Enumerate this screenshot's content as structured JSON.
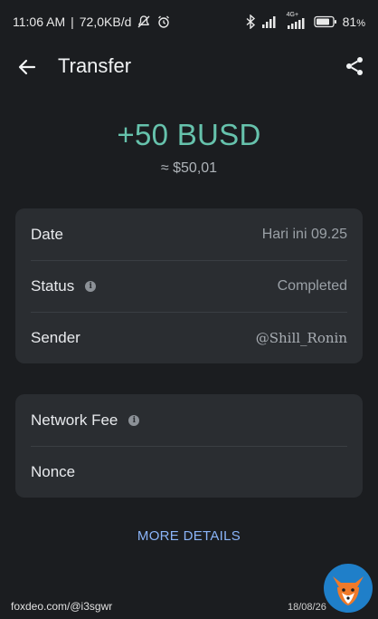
{
  "statusbar": {
    "time": "11:06 AM",
    "separator": "|",
    "netspeed": "72,0KB/d",
    "network_type": "4G+",
    "battery": "81",
    "battery_unit": "%"
  },
  "header": {
    "title": "Transfer"
  },
  "transaction": {
    "amount": "+50 BUSD",
    "fiat": "≈ $50,01"
  },
  "details": {
    "date_label": "Date",
    "date_value": "Hari ini 09.25",
    "status_label": "Status",
    "status_value": "Completed",
    "sender_label": "Sender",
    "sender_value": "@Shill_Ronin"
  },
  "fees": {
    "network_fee_label": "Network Fee",
    "nonce_label": "Nonce"
  },
  "actions": {
    "more_details": "MORE DETAILS"
  },
  "watermark": {
    "source": "foxdeo.com/@i3sgwr",
    "date": "18/08/26"
  },
  "colors": {
    "background": "#1b1d20",
    "card": "#2a2d31",
    "amount": "#66c2ac",
    "link": "#8ab4f8"
  },
  "icons": [
    "back-arrow-icon",
    "share-icon",
    "info-icon",
    "bluetooth-icon",
    "signal-icon",
    "battery-icon",
    "mute-icon",
    "alarm-icon"
  ]
}
